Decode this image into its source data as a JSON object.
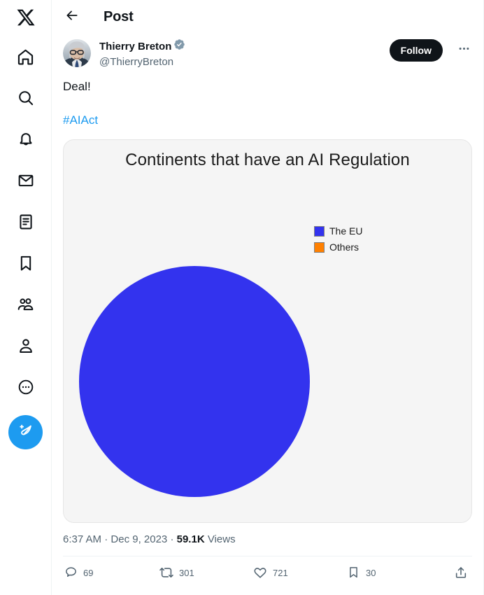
{
  "sidebar": {
    "items": [
      {
        "name": "x-logo-icon",
        "label": "X"
      },
      {
        "name": "home-icon",
        "label": "Home"
      },
      {
        "name": "search-icon",
        "label": "Explore"
      },
      {
        "name": "bell-icon",
        "label": "Notifications"
      },
      {
        "name": "mail-icon",
        "label": "Messages"
      },
      {
        "name": "lists-icon",
        "label": "Lists"
      },
      {
        "name": "bookmark-icon",
        "label": "Bookmarks"
      },
      {
        "name": "communities-icon",
        "label": "Communities"
      },
      {
        "name": "profile-icon",
        "label": "Profile"
      },
      {
        "name": "more-circle-icon",
        "label": "More"
      }
    ],
    "compose": {
      "icon": "compose-feather-icon",
      "label": "Post"
    }
  },
  "header": {
    "back_icon": "back-arrow-icon",
    "title": "Post"
  },
  "post": {
    "author_name": "Thierry Breton",
    "author_handle": "@ThierryBreton",
    "verified_badge": "verified-badge-icon",
    "follow_label": "Follow",
    "more_icon": "ellipsis-icon",
    "text": "Deal!",
    "hashtag": "#AIAct",
    "timestamp": "6:37 AM",
    "meta_separator": " · ",
    "date": "Dec 9, 2023",
    "views_count": "59.1K",
    "views_label": "Views"
  },
  "actions": [
    {
      "name": "reply",
      "icon": "reply-icon",
      "count": "69"
    },
    {
      "name": "repost",
      "icon": "repost-icon",
      "count": "301"
    },
    {
      "name": "like",
      "icon": "heart-icon",
      "count": "721"
    },
    {
      "name": "bookmark",
      "icon": "bookmark-icon",
      "count": "30"
    },
    {
      "name": "share",
      "icon": "share-icon",
      "count": ""
    }
  ],
  "colors": {
    "accent_blue": "#1d9bf0",
    "eu_blue": "#3333ee",
    "others_orange": "#ff8000",
    "text_primary": "#0f1419",
    "text_secondary": "#536471",
    "card_bg": "#f5f5f5"
  },
  "chart_data": {
    "type": "pie",
    "title": "Continents that have an AI Regulation",
    "categories": [
      "The EU",
      "Others"
    ],
    "values": [
      100,
      0
    ],
    "colors": [
      "#3333ee",
      "#ff8000"
    ],
    "legend_position": "center-right",
    "labels_shown": false,
    "legend": [
      {
        "label": "The EU",
        "color": "#3333ee",
        "value": 100
      },
      {
        "label": "Others",
        "color": "#ff8000",
        "value": 0
      }
    ]
  }
}
